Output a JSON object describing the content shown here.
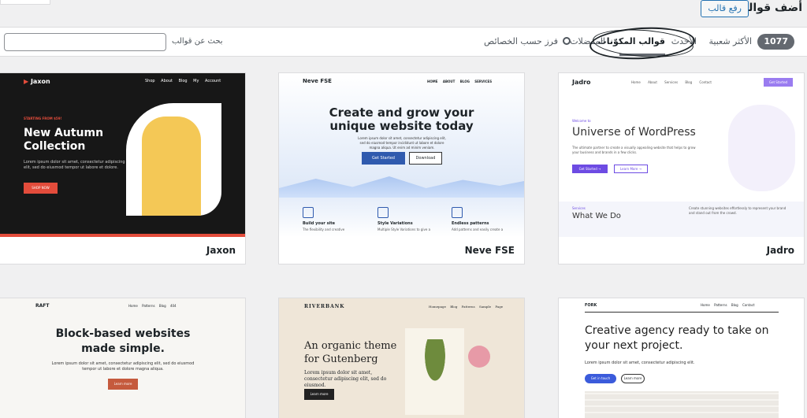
{
  "header": {
    "title": "أضف قوالب",
    "upload_label": "رفع قالب"
  },
  "filters": {
    "count": "1077",
    "tabs": [
      "الأكثر شعبية",
      "الأحدث",
      "قوالب المكوّنات",
      "المفضلات"
    ],
    "feature_filter_label": "فرز حسب الخصائص",
    "search_label": "بحث عن قوالب",
    "search_value": ""
  },
  "themes": [
    {
      "name": "Jaxon",
      "logo": "Jaxon",
      "nav": "Shop About Blog My Account",
      "tag": "STARTING FROM $59!",
      "headline_1": "New Autumn",
      "headline_2": "Collection",
      "text": "Lorem ipsum dolor sit amet, consectetur adipiscing elit, sed do eiusmod tempor ut labore et dolore.",
      "button": "SHOP NOW"
    },
    {
      "name": "Neve FSE",
      "logo": "Neve FSE",
      "nav": "HOME ABOUT BLOG SERVICES",
      "headline_1": "Create and grow your",
      "headline_2": "unique website today",
      "text": "Lorem ipsum dolor sit amet, consectetur adipiscing elit, sed do eiusmod tempor incididunt ut labore et dolore magna aliqua. Ut enim ad minim veniam.",
      "button_primary": "Get Started",
      "button_secondary": "Download",
      "features": [
        {
          "title": "Build your site",
          "text": "The flexibility and creative"
        },
        {
          "title": "Style Variations",
          "text": "Multiple Style Variations to give a"
        },
        {
          "title": "Endless patterns",
          "text": "Add patterns and easily create a"
        }
      ]
    },
    {
      "name": "Jadro",
      "logo": "Jadro",
      "nav": "Home About Services Blog Contact",
      "nav_button": "Get Started",
      "small": "Welcome to",
      "headline": "Universe of WordPress",
      "text": "The ultimate partner to create a visually appealing website that helps to grow your business and brands in a few clicks.",
      "button_primary": "Get Started →",
      "button_secondary": "Learn More →",
      "section_small": "Services",
      "section_title": "What We Do",
      "section_text": "Create stunning websites effortlessly to represent your brand and stand out from the crowd."
    },
    {
      "logo": "RAFT",
      "nav": "Home Patterns Blog 404",
      "headline_1": "Block-based websites",
      "headline_2": "made simple.",
      "text": "Lorem ipsum dolor sit amet, consectetur adipiscing elit, sed do eiusmod tempor ut labore et dolore magna aliqua.",
      "button": "Learn more"
    },
    {
      "logo": "RIVERBANK",
      "nav": "Homepage Blog Patterns Sample Page",
      "headline_1": "An organic theme",
      "headline_2": "for Gutenberg",
      "text": "Lorem ipsum dolor sit amet, consectetur adipiscing elit, sed do eiusmod.",
      "button": "Learn more"
    },
    {
      "logo": "FORK",
      "nav": "Home Patterns Blog Contact",
      "headline": "Creative agency ready to take on your next project.",
      "text": "Lorem ipsum dolor sit amet, consectetur adipiscing elit.",
      "button_primary": "Get in touch",
      "button_secondary": "Learn more"
    }
  ],
  "colors": {
    "accent": "#2271b1",
    "jaxon_red": "#e34c3b",
    "neve_blue": "#2f5aae",
    "jadro_purple": "#6d4be3"
  }
}
